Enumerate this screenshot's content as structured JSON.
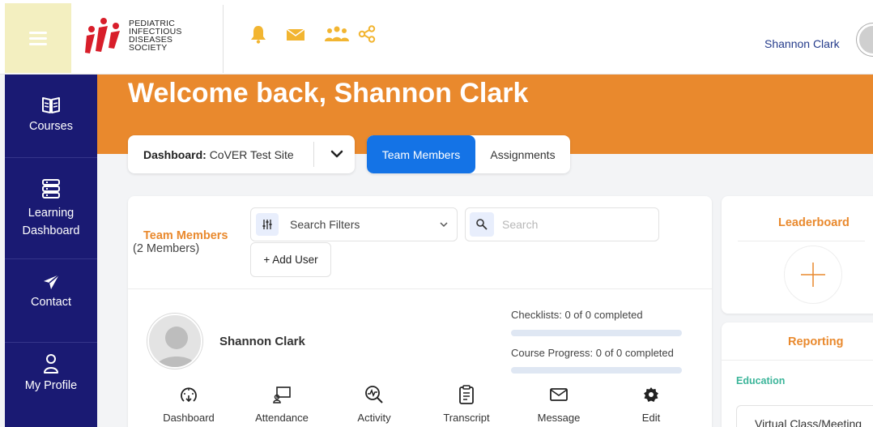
{
  "header": {
    "logo_lines": [
      "PEDIATRIC",
      "INFECTIOUS",
      "DISEASES",
      "SOCIETY"
    ],
    "icons": [
      "bell-icon",
      "envelope-icon",
      "group-icon",
      "share-icon"
    ],
    "user_name": "Shannon Clark",
    "accent_color": "#f2b531"
  },
  "sidebar": {
    "items": [
      {
        "label": "Courses",
        "icon": "book-icon"
      },
      {
        "label": "Learning Dashboard",
        "icon": "list-icon"
      },
      {
        "label": "Contact",
        "icon": "paper-plane-icon"
      },
      {
        "label": "My Profile",
        "icon": "person-icon"
      }
    ],
    "background": "#1a1a73"
  },
  "banner": {
    "welcome": "Welcome back, Shannon Clark",
    "background": "#e9892d"
  },
  "dashboard_select": {
    "label": "Dashboard:",
    "value": "CoVER Test Site"
  },
  "tabs": [
    {
      "label": "Team Members",
      "active": true
    },
    {
      "label": "Assignments",
      "active": false
    }
  ],
  "team_card": {
    "title": "Team Members",
    "count": "(2 Members)",
    "filters_label": "Search Filters",
    "search_placeholder": "Search",
    "add_user": "+ Add User",
    "member": {
      "name": "Shannon Clark",
      "checklists": "Checklists: 0 of 0 completed",
      "checklists_progress": 0,
      "course_progress": "Course Progress: 0 of 0 completed",
      "course_progress_value": 0
    },
    "actions": [
      {
        "label": "Dashboard",
        "icon": "dashboard-gauge-icon"
      },
      {
        "label": "Attendance",
        "icon": "attendance-icon"
      },
      {
        "label": "Activity",
        "icon": "activity-icon"
      },
      {
        "label": "Transcript",
        "icon": "clipboard-icon"
      },
      {
        "label": "Message",
        "icon": "envelope-icon"
      },
      {
        "label": "Edit",
        "icon": "gear-icon"
      }
    ]
  },
  "leaderboard": {
    "title": "Leaderboard"
  },
  "reporting": {
    "title": "Reporting",
    "section": "Education",
    "item": "Virtual Class/Meeting"
  }
}
